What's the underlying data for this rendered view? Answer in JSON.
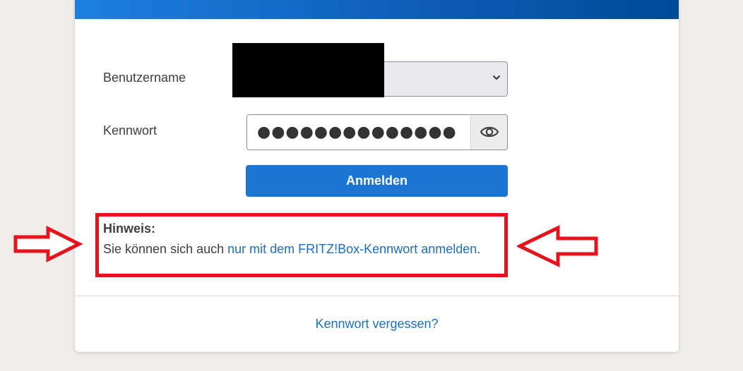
{
  "login": {
    "username_label": "Benutzername",
    "password_label": "Kennwort",
    "password_value": "●●●●●●●●●●●●●●",
    "login_button": "Anmelden"
  },
  "hint": {
    "title": "Hinweis:",
    "text_before": "Sie können sich auch ",
    "link": "nur mit dem FRITZ!Box-Kennwort anmelden",
    "text_after": "."
  },
  "footer": {
    "forgot_link": "Kennwort vergessen?"
  },
  "colors": {
    "accent": "#1a76d2",
    "link": "#1a6fc2",
    "annotation": "#e3141d"
  }
}
